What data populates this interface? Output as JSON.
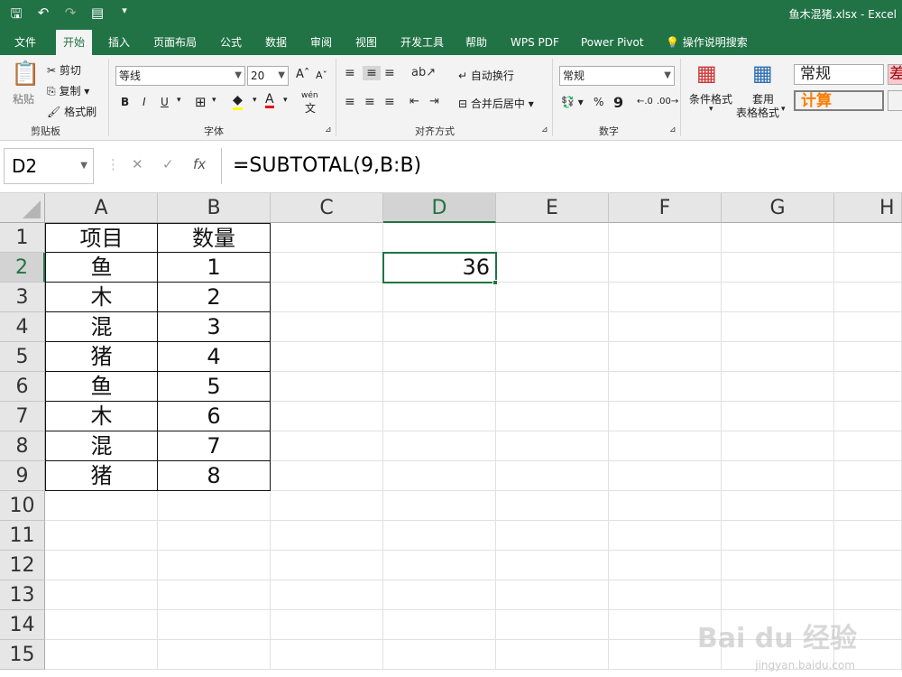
{
  "window": {
    "title": "鱼木混猪.xlsx  -  Excel"
  },
  "qat": {
    "save_icon": "save-icon",
    "undo_icon": "undo-icon",
    "redo_icon": "redo-icon",
    "form_icon": "form-icon",
    "customize_icon": "customize-icon"
  },
  "menu": {
    "tabs": [
      "文件",
      "开始",
      "插入",
      "页面布局",
      "公式",
      "数据",
      "审阅",
      "视图",
      "开发工具",
      "帮助",
      "WPS PDF",
      "Power Pivot"
    ],
    "search": "操作说明搜索",
    "active": "开始"
  },
  "ribbon": {
    "clipboard": {
      "paste": "粘贴",
      "cut": "剪切",
      "copy": "复制",
      "format_painter": "格式刷",
      "label": "剪贴板"
    },
    "font": {
      "name": "等线",
      "size": "20",
      "label": "字体",
      "bold": "B",
      "italic": "I",
      "underline": "U",
      "grow": "A",
      "shrink": "A",
      "fontcolor": "A",
      "wen": "wén"
    },
    "alignment": {
      "wrap": "自动换行",
      "merge": "合并后居中",
      "label": "对齐方式"
    },
    "number": {
      "format": "常规",
      "percent": "%",
      "comma": "9",
      "label": "数字"
    },
    "styles": {
      "conditional": "条件格式",
      "table_format_1": "套用",
      "table_format_2": "表格格式",
      "style_normal": "常规",
      "style_calc": "计算",
      "style_bad": "差"
    }
  },
  "formula_bar": {
    "name_box": "D2",
    "cancel": "✕",
    "enter": "✓",
    "fx": "fx",
    "formula": "=SUBTOTAL(9,B:B)"
  },
  "grid": {
    "columns": [
      "A",
      "B",
      "C",
      "D",
      "E",
      "F",
      "G",
      "H"
    ],
    "rows": [
      "1",
      "2",
      "3",
      "4",
      "5",
      "6",
      "7",
      "8",
      "9",
      "10",
      "11",
      "12",
      "13",
      "14",
      "15"
    ],
    "selected_cell": "D2",
    "header": {
      "a": "项目",
      "b": "数量"
    },
    "data": [
      {
        "a": "鱼",
        "b": "1"
      },
      {
        "a": "木",
        "b": "2"
      },
      {
        "a": "混",
        "b": "3"
      },
      {
        "a": "猪",
        "b": "4"
      },
      {
        "a": "鱼",
        "b": "5"
      },
      {
        "a": "木",
        "b": "6"
      },
      {
        "a": "混",
        "b": "7"
      },
      {
        "a": "猪",
        "b": "8"
      }
    ],
    "d2": "36"
  },
  "watermark": {
    "brand": "Bai du 经验",
    "url": "jingyan.baidu.com"
  },
  "colors": {
    "accent": "#217346",
    "style_calc": "#fa7d00"
  }
}
